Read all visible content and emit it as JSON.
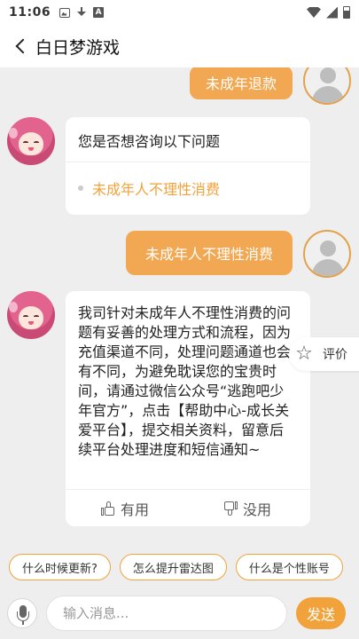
{
  "status_bar": {
    "time": "11:06"
  },
  "header": {
    "title": "白日梦游戏"
  },
  "messages": {
    "user_1": "未成年退款",
    "menu": {
      "question": "您是否想咨询以下问题",
      "option": "未成年人不理性消费"
    },
    "user_2": "未成年人不理性消费",
    "reply": {
      "text": "我司针对未成年人不理性消费的问题有妥善的处理方式和流程，因为充值渠道不同，处理问题通道也会有不同，为避免耽误您的宝贵时间，请通过微信公众号“逃跑吧少年官方”，点击【帮助中心-成长关爱平台】，提交相关资料，留意后续平台处理进度和短信通知~",
      "useful": "有用",
      "useless": "没用"
    }
  },
  "rate_tab": {
    "label": "评价"
  },
  "quick_chips": [
    "什么时候更新?",
    "怎么提升雷达图",
    "什么是个性账号"
  ],
  "input": {
    "placeholder": "输入消息...",
    "send_label": "发送"
  },
  "colors": {
    "accent": "#f2a23a",
    "user_bubble": "#f2a852",
    "background": "#eeeeee"
  },
  "icons": [
    "back-arrow-icon",
    "user-avatar-icon",
    "bot-avatar-icon",
    "thumbs-up-icon",
    "thumbs-down-icon",
    "star-icon",
    "microphone-icon"
  ]
}
